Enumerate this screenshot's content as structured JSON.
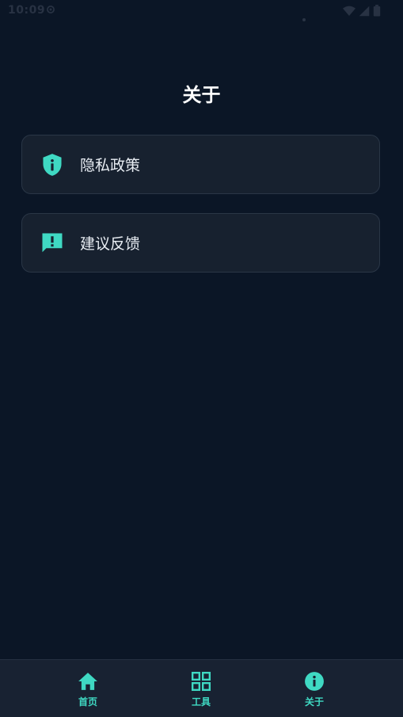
{
  "status_bar": {
    "time": "10:09"
  },
  "page": {
    "title": "关于"
  },
  "menu": {
    "items": [
      {
        "label": "隐私政策",
        "icon": "shield-info-icon"
      },
      {
        "label": "建议反馈",
        "icon": "feedback-icon"
      }
    ]
  },
  "bottom_nav": {
    "items": [
      {
        "label": "首页",
        "icon": "home-icon"
      },
      {
        "label": "工具",
        "icon": "grid-icon"
      },
      {
        "label": "关于",
        "icon": "info-icon"
      }
    ]
  },
  "colors": {
    "background": "#0b1626",
    "card": "#17212f",
    "accent": "#3fd9c3",
    "nav_background": "#182232"
  }
}
